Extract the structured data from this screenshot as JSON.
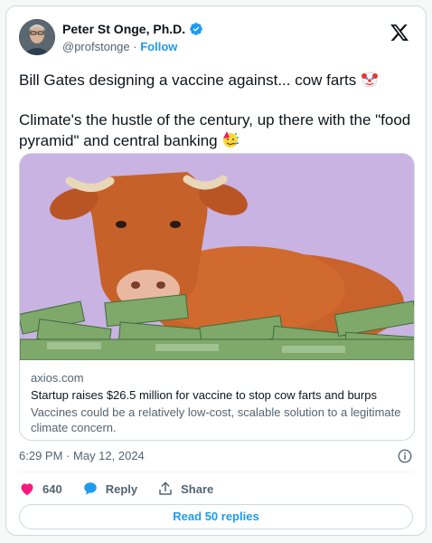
{
  "author": {
    "display_name": "Peter St Onge, Ph.D.",
    "handle": "@profstonge",
    "separator": "·",
    "follow_label": "Follow"
  },
  "tweet": {
    "line1": "Bill Gates designing a vaccine against... cow farts",
    "line2": "Climate's the hustle of the century, up there with the \"food pyramid\" and central banking",
    "emoji1": "clown-face",
    "emoji2": "party-face"
  },
  "link_card": {
    "domain": "axios.com",
    "headline": "Startup raises $26.5 million for vaccine to stop cow farts and burps",
    "description": "Vaccines could be a relatively low-cost, scalable solution to a legitimate climate concern."
  },
  "meta": {
    "time": "6:29 PM",
    "separator": "·",
    "date": "May 12, 2024"
  },
  "actions": {
    "likes": "640",
    "reply_label": "Reply",
    "share_label": "Share"
  },
  "read_replies_label": "Read 50 replies",
  "colors": {
    "accent": "#1d9bf0",
    "like": "#f91880",
    "image_background": "#c9b3e3"
  }
}
